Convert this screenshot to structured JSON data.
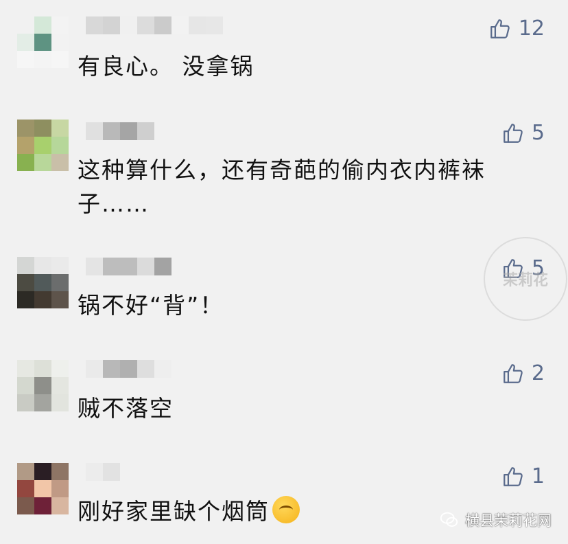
{
  "comments": [
    {
      "text": "有良心。 没拿锅",
      "likes": "12",
      "avatar": [
        "#f1f1f1",
        "#d4e8d8",
        "#f3f3f3",
        "#e3ede6",
        "#5e9382",
        "#f2f2f2",
        "#f6f6f6",
        "#f4f4f4",
        "#f6f6f6"
      ],
      "name": [
        "#d8d8d8",
        "#d3d3d3",
        "#f0f0f0",
        "#dcdcdc",
        "#cbcbcb",
        "#f2f2f2",
        "#e6e6e6",
        "#e7e7e7"
      ]
    },
    {
      "text": "这种算什么，还有奇葩的偷内衣内裤袜子……",
      "likes": "5",
      "avatar": [
        "#9c9468",
        "#8e8f60",
        "#c7d7a3",
        "#b4a26b",
        "#a8d06d",
        "#b6d79a",
        "#88b150",
        "#b8d79a",
        "#c9bfa8"
      ],
      "name": [
        "#e0e0e0",
        "#b9b9b9",
        "#a5a5a5",
        "#cfcfcf"
      ]
    },
    {
      "text": "锅不好“背”！",
      "likes": "5",
      "avatar": [
        "#d4d6d4",
        "#e7e7e7",
        "#eaeaea",
        "#4c4b42",
        "#515a5a",
        "#6b6d6d",
        "#2c2a25",
        "#433a31",
        "#5e544b"
      ],
      "name": [
        "#e4e4e4",
        "#bdbdbd",
        "#bdbdbd",
        "#dbdbdb",
        "#a3a3a3"
      ]
    },
    {
      "text": "贼不落空",
      "likes": "2",
      "avatar": [
        "#e6e8e2",
        "#dde0d8",
        "#eef0ec",
        "#d4d8cf",
        "#8e8f8a",
        "#e4e6e0",
        "#c9cbc4",
        "#a3a49f",
        "#e2e4de"
      ],
      "name": [
        "#eaeaea",
        "#b8b8b8",
        "#b0b0b0",
        "#dedede",
        "#eeeeee"
      ]
    },
    {
      "text": "刚好家里缺个烟筒",
      "likes": "1",
      "avatar": [
        "#b19a86",
        "#2a1e24",
        "#8e7565",
        "#93473f",
        "#f2c6a8",
        "#c09a85",
        "#7b5a4d",
        "#6e2138",
        "#d8b6a0"
      ],
      "name": [
        "#ececec",
        "#e2e2e2"
      ]
    }
  ],
  "watermark_text": "茉莉花",
  "source_label": "横县茉莉花网"
}
